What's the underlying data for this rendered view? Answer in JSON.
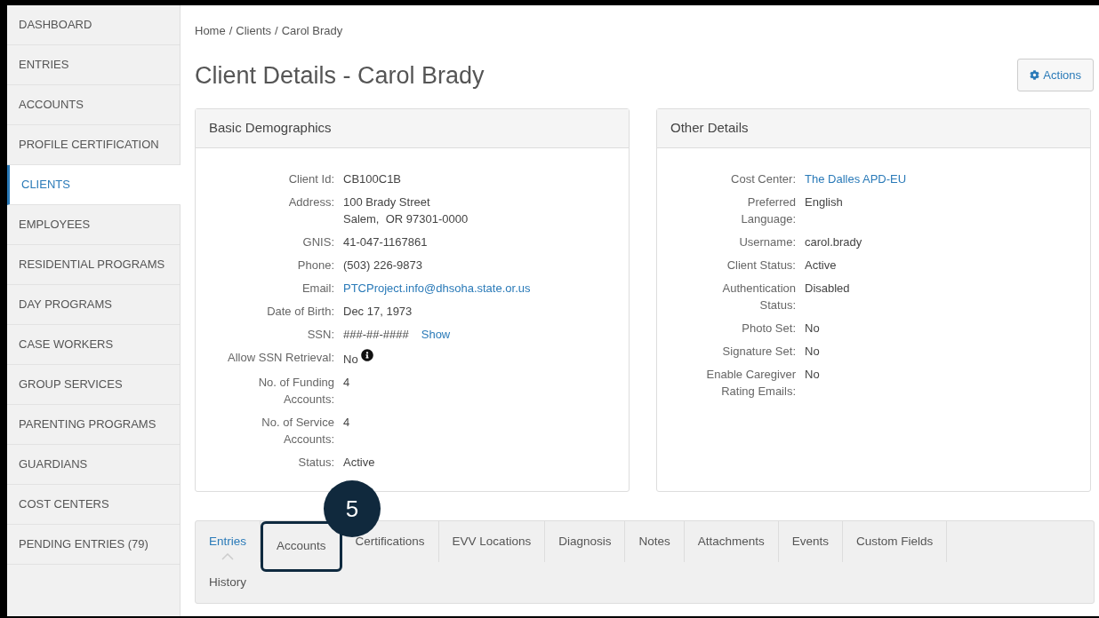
{
  "sidebar": {
    "items": [
      {
        "label": "DASHBOARD",
        "selected": false
      },
      {
        "label": "ENTRIES",
        "selected": false
      },
      {
        "label": "ACCOUNTS",
        "selected": false
      },
      {
        "label": "PROFILE CERTIFICATION",
        "selected": false
      },
      {
        "label": "CLIENTS",
        "selected": true
      },
      {
        "label": "EMPLOYEES",
        "selected": false
      },
      {
        "label": "RESIDENTIAL PROGRAMS",
        "selected": false
      },
      {
        "label": "DAY PROGRAMS",
        "selected": false
      },
      {
        "label": "CASE WORKERS",
        "selected": false
      },
      {
        "label": "GROUP SERVICES",
        "selected": false
      },
      {
        "label": "PARENTING PROGRAMS",
        "selected": false
      },
      {
        "label": "GUARDIANS",
        "selected": false
      },
      {
        "label": "COST CENTERS",
        "selected": false
      },
      {
        "label": "PENDING ENTRIES (79)",
        "selected": false
      }
    ]
  },
  "breadcrumb": {
    "separator": "/",
    "items": [
      "Home",
      "Clients",
      "Carol Brady"
    ]
  },
  "title": "Client Details - Carol Brady",
  "actions_button": "Actions",
  "panels": [
    {
      "title": "Basic Demographics",
      "rows": [
        {
          "label": "Client Id:",
          "kind": "text",
          "value": "CB100C1B"
        },
        {
          "label": "Address:",
          "kind": "lines",
          "lines": [
            "100 Brady Street",
            "Salem,  OR 97301-0000"
          ]
        },
        {
          "label": "GNIS:",
          "kind": "text",
          "value": "41-047-1167861"
        },
        {
          "label": "Phone:",
          "kind": "text",
          "value": "(503) 226-9873"
        },
        {
          "label": "Email:",
          "kind": "link",
          "value": "PTCProject.info@dhsoha.state.or.us"
        },
        {
          "label": "Date of Birth:",
          "kind": "text",
          "value": "Dec 17, 1973"
        },
        {
          "label": "SSN:",
          "kind": "masked",
          "value": "###-##-####",
          "action": "Show"
        },
        {
          "label": "Allow SSN Retrieval:",
          "kind": "info",
          "value": "No"
        },
        {
          "label": "No. of Funding Accounts:",
          "kind": "text",
          "value": "4"
        },
        {
          "label": "No. of Service Accounts:",
          "kind": "text",
          "value": "4"
        },
        {
          "label": "Status:",
          "kind": "text",
          "value": "Active"
        }
      ]
    },
    {
      "title": "Other Details",
      "rows": [
        {
          "label": "Cost Center:",
          "kind": "link",
          "value": "The Dalles APD-EU"
        },
        {
          "label": "Preferred Language:",
          "kind": "text",
          "value": "English"
        },
        {
          "label": "Username:",
          "kind": "text",
          "value": "carol.brady"
        },
        {
          "label": "Client Status:",
          "kind": "text",
          "value": "Active"
        },
        {
          "label": "Authentication Status:",
          "kind": "text",
          "value": "Disabled"
        },
        {
          "label": "Photo Set:",
          "kind": "text",
          "value": "No"
        },
        {
          "label": "Signature Set:",
          "kind": "text",
          "value": "No"
        },
        {
          "label": "Enable Caregiver Rating Emails:",
          "kind": "text",
          "value": "No"
        }
      ]
    }
  ],
  "tabs": [
    {
      "label": "Entries",
      "selected": true,
      "highlighted": false
    },
    {
      "label": "Accounts",
      "selected": false,
      "highlighted": true
    },
    {
      "label": "Certifications",
      "selected": false,
      "highlighted": false
    },
    {
      "label": "EVV Locations",
      "selected": false,
      "highlighted": false
    },
    {
      "label": "Diagnosis",
      "selected": false,
      "highlighted": false
    },
    {
      "label": "Notes",
      "selected": false,
      "highlighted": false
    },
    {
      "label": "Attachments",
      "selected": false,
      "highlighted": false
    },
    {
      "label": "Events",
      "selected": false,
      "highlighted": false
    },
    {
      "label": "Custom Fields",
      "selected": false,
      "highlighted": false
    },
    {
      "label": "History",
      "selected": false,
      "highlighted": false
    }
  ],
  "callout": {
    "number": "5"
  }
}
